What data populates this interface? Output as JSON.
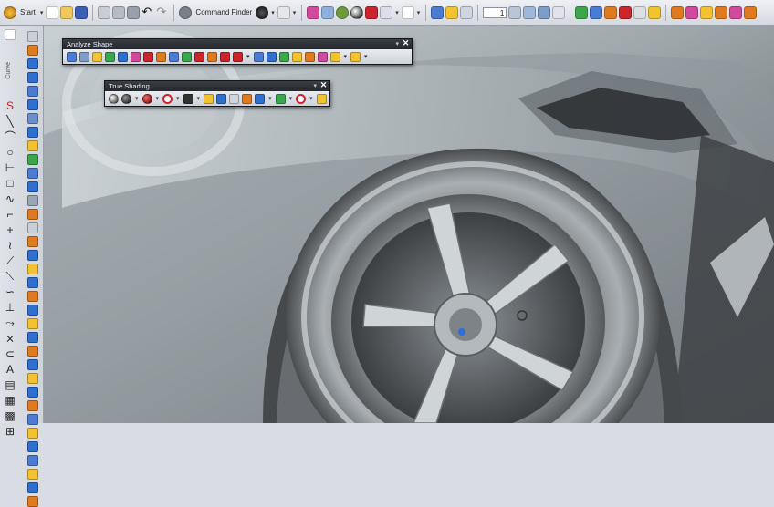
{
  "toolbar": {
    "start_label": "Start",
    "command_finder_label": "Command Finder",
    "scale_value": "1"
  },
  "left_toolbar": {
    "vertical_label": "Curve"
  },
  "analyze_shape": {
    "title": "Analyze Shape"
  },
  "true_shading": {
    "title": "True Shading"
  },
  "colors": {
    "accent_blue": "#2f6fd0",
    "accent_red": "#c9252b",
    "accent_yellow": "#f2c230",
    "accent_green": "#3aa84a",
    "accent_orange": "#e07a1f"
  }
}
